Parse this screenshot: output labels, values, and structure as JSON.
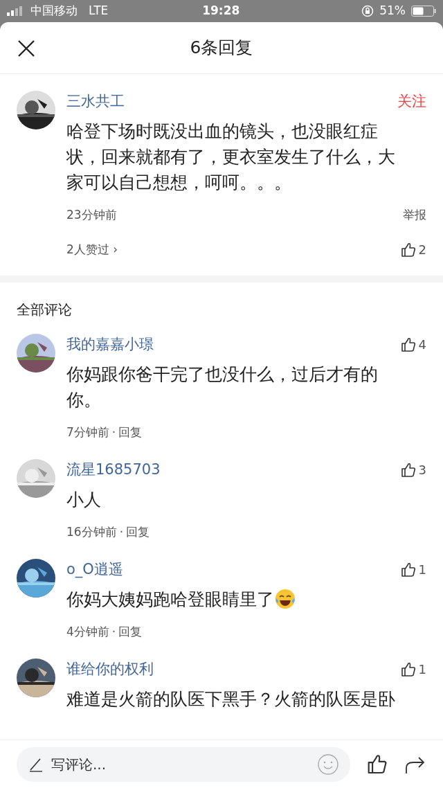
{
  "status_bar": {
    "carrier": "中国移动",
    "network": "LTE",
    "time": "19:28",
    "battery": "51%"
  },
  "header": {
    "title": "6条回复"
  },
  "main_comment": {
    "author": "三水共工",
    "follow": "关注",
    "text": "哈登下场时既没出血的镜头，也没眼红症状，回来就都有了，更衣室发生了什么，大家可以自己想想，呵呵。。。",
    "time": "23分钟前",
    "report": "举报",
    "likers": "2人赞过",
    "chevron": "›",
    "likes": "2"
  },
  "section_title": "全部评论",
  "comments": [
    {
      "author": "我的嘉嘉小璟",
      "text": "你妈跟你爸干完了也没什么，过后才有的你。",
      "emoji": false,
      "time": "7分钟前",
      "dot": "·",
      "reply": "回复",
      "likes": "4"
    },
    {
      "author": "流星1685703",
      "text": "小人",
      "emoji": false,
      "time": "16分钟前",
      "dot": "·",
      "reply": "回复",
      "likes": "3"
    },
    {
      "author": "o_O逍遥",
      "text": "你妈大姨妈跑哈登眼睛里了",
      "emoji": true,
      "time": "4分钟前",
      "dot": "·",
      "reply": "回复",
      "likes": "1"
    },
    {
      "author": "谁给你的权利",
      "text": "难道是火箭的队医下黑手？火箭的队医是卧",
      "emoji": false,
      "likes": "1"
    }
  ],
  "footer": {
    "placeholder": "写评论..."
  }
}
